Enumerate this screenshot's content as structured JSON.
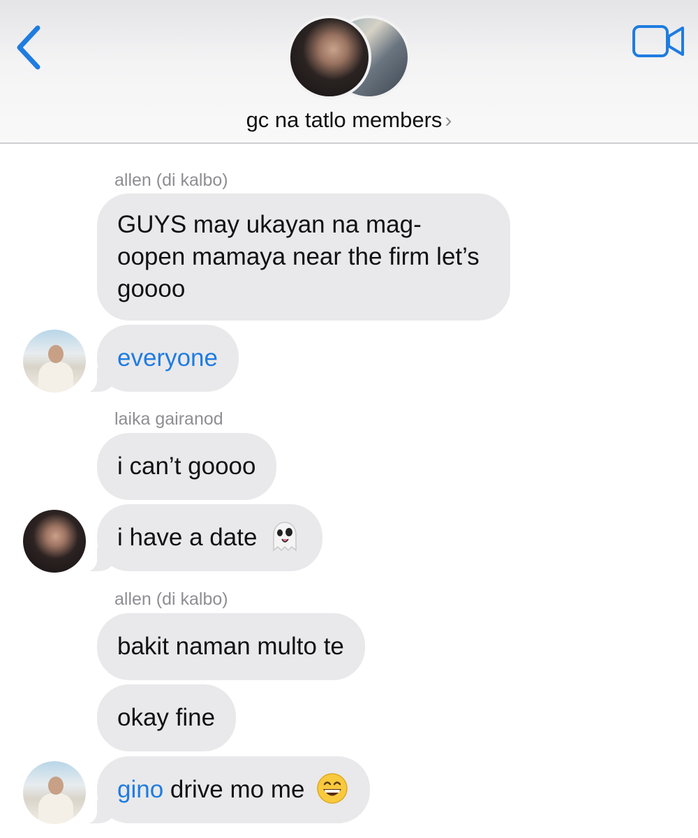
{
  "header": {
    "group_name": "gc na tatlo members",
    "chevron": "›",
    "back_icon": "chevron-left-icon",
    "video_icon": "video-camera-icon",
    "accent": "#1f7ce0"
  },
  "messages": [
    {
      "sender": "allen (di kalbo)",
      "text": "GUYS may ukayan na mag-oopen mamaya near the firm let’s goooo"
    },
    {
      "mention": "everyone"
    },
    {
      "sender": "laika gairanod",
      "text": "i can’t goooo"
    },
    {
      "text": "i have a date",
      "emoji": "ghost-emoji"
    },
    {
      "sender": "allen (di kalbo)",
      "text": "bakit naman multo te"
    },
    {
      "text": "okay fine"
    },
    {
      "mention": "gino",
      "text": " drive mo me",
      "emoji": "grinning-face-emoji"
    }
  ],
  "colors": {
    "bubble_gray": "#e9e9eb",
    "mention_blue": "#1f7ce0",
    "sender_gray": "#8e8e93"
  }
}
